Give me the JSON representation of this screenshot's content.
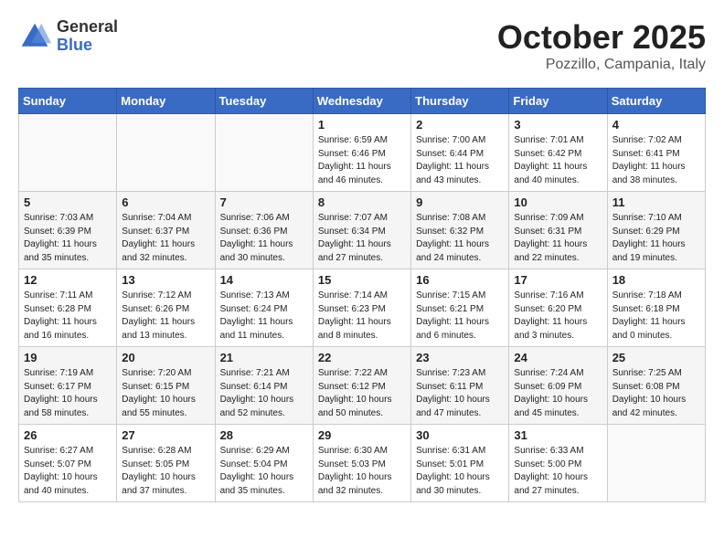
{
  "logo": {
    "general": "General",
    "blue": "Blue"
  },
  "title": {
    "month_year": "October 2025",
    "location": "Pozzillo, Campania, Italy"
  },
  "weekdays": [
    "Sunday",
    "Monday",
    "Tuesday",
    "Wednesday",
    "Thursday",
    "Friday",
    "Saturday"
  ],
  "weeks": [
    [
      {
        "day": "",
        "info": ""
      },
      {
        "day": "",
        "info": ""
      },
      {
        "day": "",
        "info": ""
      },
      {
        "day": "1",
        "info": "Sunrise: 6:59 AM\nSunset: 6:46 PM\nDaylight: 11 hours\nand 46 minutes."
      },
      {
        "day": "2",
        "info": "Sunrise: 7:00 AM\nSunset: 6:44 PM\nDaylight: 11 hours\nand 43 minutes."
      },
      {
        "day": "3",
        "info": "Sunrise: 7:01 AM\nSunset: 6:42 PM\nDaylight: 11 hours\nand 40 minutes."
      },
      {
        "day": "4",
        "info": "Sunrise: 7:02 AM\nSunset: 6:41 PM\nDaylight: 11 hours\nand 38 minutes."
      }
    ],
    [
      {
        "day": "5",
        "info": "Sunrise: 7:03 AM\nSunset: 6:39 PM\nDaylight: 11 hours\nand 35 minutes."
      },
      {
        "day": "6",
        "info": "Sunrise: 7:04 AM\nSunset: 6:37 PM\nDaylight: 11 hours\nand 32 minutes."
      },
      {
        "day": "7",
        "info": "Sunrise: 7:06 AM\nSunset: 6:36 PM\nDaylight: 11 hours\nand 30 minutes."
      },
      {
        "day": "8",
        "info": "Sunrise: 7:07 AM\nSunset: 6:34 PM\nDaylight: 11 hours\nand 27 minutes."
      },
      {
        "day": "9",
        "info": "Sunrise: 7:08 AM\nSunset: 6:32 PM\nDaylight: 11 hours\nand 24 minutes."
      },
      {
        "day": "10",
        "info": "Sunrise: 7:09 AM\nSunset: 6:31 PM\nDaylight: 11 hours\nand 22 minutes."
      },
      {
        "day": "11",
        "info": "Sunrise: 7:10 AM\nSunset: 6:29 PM\nDaylight: 11 hours\nand 19 minutes."
      }
    ],
    [
      {
        "day": "12",
        "info": "Sunrise: 7:11 AM\nSunset: 6:28 PM\nDaylight: 11 hours\nand 16 minutes."
      },
      {
        "day": "13",
        "info": "Sunrise: 7:12 AM\nSunset: 6:26 PM\nDaylight: 11 hours\nand 13 minutes."
      },
      {
        "day": "14",
        "info": "Sunrise: 7:13 AM\nSunset: 6:24 PM\nDaylight: 11 hours\nand 11 minutes."
      },
      {
        "day": "15",
        "info": "Sunrise: 7:14 AM\nSunset: 6:23 PM\nDaylight: 11 hours\nand 8 minutes."
      },
      {
        "day": "16",
        "info": "Sunrise: 7:15 AM\nSunset: 6:21 PM\nDaylight: 11 hours\nand 6 minutes."
      },
      {
        "day": "17",
        "info": "Sunrise: 7:16 AM\nSunset: 6:20 PM\nDaylight: 11 hours\nand 3 minutes."
      },
      {
        "day": "18",
        "info": "Sunrise: 7:18 AM\nSunset: 6:18 PM\nDaylight: 11 hours\nand 0 minutes."
      }
    ],
    [
      {
        "day": "19",
        "info": "Sunrise: 7:19 AM\nSunset: 6:17 PM\nDaylight: 10 hours\nand 58 minutes."
      },
      {
        "day": "20",
        "info": "Sunrise: 7:20 AM\nSunset: 6:15 PM\nDaylight: 10 hours\nand 55 minutes."
      },
      {
        "day": "21",
        "info": "Sunrise: 7:21 AM\nSunset: 6:14 PM\nDaylight: 10 hours\nand 52 minutes."
      },
      {
        "day": "22",
        "info": "Sunrise: 7:22 AM\nSunset: 6:12 PM\nDaylight: 10 hours\nand 50 minutes."
      },
      {
        "day": "23",
        "info": "Sunrise: 7:23 AM\nSunset: 6:11 PM\nDaylight: 10 hours\nand 47 minutes."
      },
      {
        "day": "24",
        "info": "Sunrise: 7:24 AM\nSunset: 6:09 PM\nDaylight: 10 hours\nand 45 minutes."
      },
      {
        "day": "25",
        "info": "Sunrise: 7:25 AM\nSunset: 6:08 PM\nDaylight: 10 hours\nand 42 minutes."
      }
    ],
    [
      {
        "day": "26",
        "info": "Sunrise: 6:27 AM\nSunset: 5:07 PM\nDaylight: 10 hours\nand 40 minutes."
      },
      {
        "day": "27",
        "info": "Sunrise: 6:28 AM\nSunset: 5:05 PM\nDaylight: 10 hours\nand 37 minutes."
      },
      {
        "day": "28",
        "info": "Sunrise: 6:29 AM\nSunset: 5:04 PM\nDaylight: 10 hours\nand 35 minutes."
      },
      {
        "day": "29",
        "info": "Sunrise: 6:30 AM\nSunset: 5:03 PM\nDaylight: 10 hours\nand 32 minutes."
      },
      {
        "day": "30",
        "info": "Sunrise: 6:31 AM\nSunset: 5:01 PM\nDaylight: 10 hours\nand 30 minutes."
      },
      {
        "day": "31",
        "info": "Sunrise: 6:33 AM\nSunset: 5:00 PM\nDaylight: 10 hours\nand 27 minutes."
      },
      {
        "day": "",
        "info": ""
      }
    ]
  ]
}
